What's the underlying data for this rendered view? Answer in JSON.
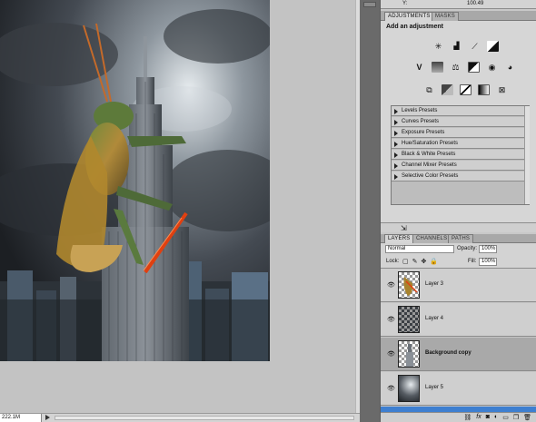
{
  "info": {
    "label": "Y:",
    "value": "100.49"
  },
  "adjustments": {
    "tabs": [
      {
        "label": "ADJUSTMENTS"
      },
      {
        "label": "MASKS"
      }
    ],
    "title": "Add an adjustment",
    "icons_row1": [
      "brightness-contrast",
      "levels",
      "curves",
      "exposure"
    ],
    "icons_row2": [
      "vibrance",
      "hue-saturation",
      "color-balance",
      "black-white",
      "photo-filter",
      "channel-mixer"
    ],
    "icons_row3": [
      "invert",
      "posterize",
      "threshold",
      "gradient-map",
      "selective-color"
    ],
    "presets": [
      {
        "label": "Levels Presets"
      },
      {
        "label": "Curves Presets"
      },
      {
        "label": "Exposure Presets"
      },
      {
        "label": "Hue/Saturation Presets"
      },
      {
        "label": "Black & White Presets"
      },
      {
        "label": "Channel Mixer Presets"
      },
      {
        "label": "Selective Color Presets"
      }
    ]
  },
  "layers": {
    "tabs": [
      {
        "label": "LAYERS"
      },
      {
        "label": "CHANNELS"
      },
      {
        "label": "PATHS"
      }
    ],
    "blend_mode": "Normal",
    "opacity_label": "Opacity:",
    "opacity_value": "100%",
    "lock_label": "Lock:",
    "fill_label": "Fill:",
    "fill_value": "100%",
    "items": [
      {
        "name": "Layer 3",
        "selected": false
      },
      {
        "name": "Layer 4",
        "selected": false
      },
      {
        "name": "Background copy",
        "selected": true
      },
      {
        "name": "Layer 5",
        "selected": false
      }
    ]
  },
  "status": {
    "zoom": "222.1M"
  }
}
